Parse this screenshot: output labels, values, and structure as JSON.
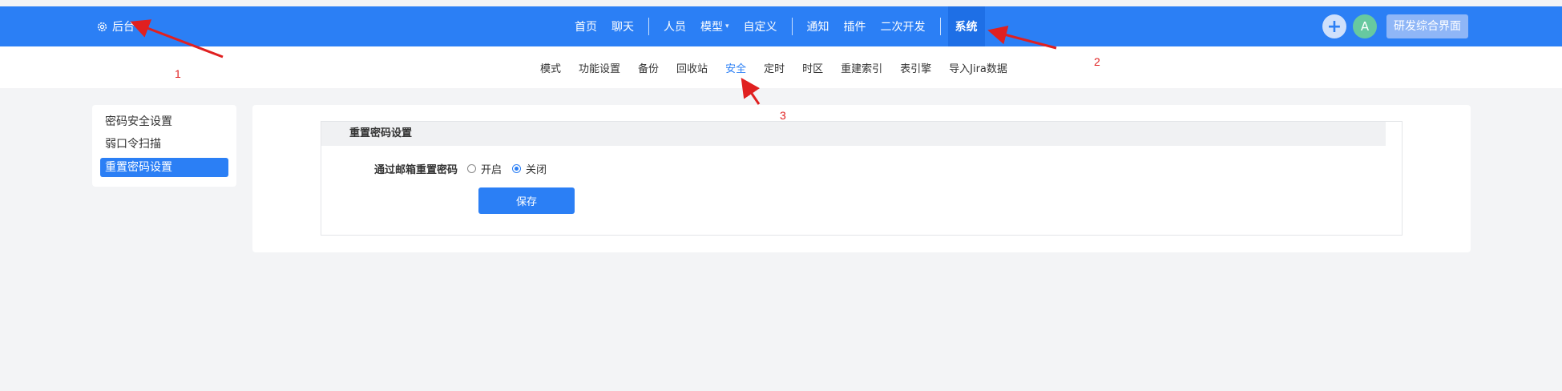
{
  "topbar": {
    "backend_label": "后台",
    "nav": [
      {
        "label": "首页"
      },
      {
        "label": "聊天"
      },
      {
        "label": "人员"
      },
      {
        "label": "模型"
      },
      {
        "label": "自定义"
      },
      {
        "label": "通知"
      },
      {
        "label": "插件"
      },
      {
        "label": "二次开发"
      },
      {
        "label": "系统"
      }
    ],
    "avatar_letter": "A",
    "portal_label": "研发综合界面",
    "brand_color": "#2b7ff5"
  },
  "subtabs": [
    {
      "label": "模式"
    },
    {
      "label": "功能设置"
    },
    {
      "label": "备份"
    },
    {
      "label": "回收站"
    },
    {
      "label": "安全"
    },
    {
      "label": "定时"
    },
    {
      "label": "时区"
    },
    {
      "label": "重建索引"
    },
    {
      "label": "表引擎"
    },
    {
      "label": "导入Jira数据"
    }
  ],
  "sidebar": {
    "items": [
      {
        "label": "密码安全设置"
      },
      {
        "label": "弱口令扫描"
      },
      {
        "label": "重置密码设置"
      }
    ]
  },
  "panel": {
    "title": "重置密码设置",
    "field_label": "通过邮箱重置密码",
    "options": [
      {
        "label": "开启",
        "checked": false
      },
      {
        "label": "关闭",
        "checked": true
      }
    ],
    "save_label": "保存"
  },
  "annotations": [
    "1",
    "2",
    "3"
  ],
  "annotation_color": "#e02020"
}
